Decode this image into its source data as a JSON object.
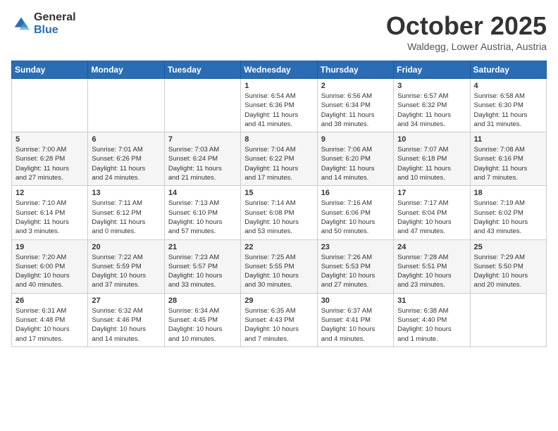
{
  "header": {
    "logo_general": "General",
    "logo_blue": "Blue",
    "month_title": "October 2025",
    "location": "Waldegg, Lower Austria, Austria"
  },
  "weekdays": [
    "Sunday",
    "Monday",
    "Tuesday",
    "Wednesday",
    "Thursday",
    "Friday",
    "Saturday"
  ],
  "weeks": [
    [
      {
        "day": "",
        "info": ""
      },
      {
        "day": "",
        "info": ""
      },
      {
        "day": "",
        "info": ""
      },
      {
        "day": "1",
        "info": "Sunrise: 6:54 AM\nSunset: 6:36 PM\nDaylight: 11 hours\nand 41 minutes."
      },
      {
        "day": "2",
        "info": "Sunrise: 6:56 AM\nSunset: 6:34 PM\nDaylight: 11 hours\nand 38 minutes."
      },
      {
        "day": "3",
        "info": "Sunrise: 6:57 AM\nSunset: 6:32 PM\nDaylight: 11 hours\nand 34 minutes."
      },
      {
        "day": "4",
        "info": "Sunrise: 6:58 AM\nSunset: 6:30 PM\nDaylight: 11 hours\nand 31 minutes."
      }
    ],
    [
      {
        "day": "5",
        "info": "Sunrise: 7:00 AM\nSunset: 6:28 PM\nDaylight: 11 hours\nand 27 minutes."
      },
      {
        "day": "6",
        "info": "Sunrise: 7:01 AM\nSunset: 6:26 PM\nDaylight: 11 hours\nand 24 minutes."
      },
      {
        "day": "7",
        "info": "Sunrise: 7:03 AM\nSunset: 6:24 PM\nDaylight: 11 hours\nand 21 minutes."
      },
      {
        "day": "8",
        "info": "Sunrise: 7:04 AM\nSunset: 6:22 PM\nDaylight: 11 hours\nand 17 minutes."
      },
      {
        "day": "9",
        "info": "Sunrise: 7:06 AM\nSunset: 6:20 PM\nDaylight: 11 hours\nand 14 minutes."
      },
      {
        "day": "10",
        "info": "Sunrise: 7:07 AM\nSunset: 6:18 PM\nDaylight: 11 hours\nand 10 minutes."
      },
      {
        "day": "11",
        "info": "Sunrise: 7:08 AM\nSunset: 6:16 PM\nDaylight: 11 hours\nand 7 minutes."
      }
    ],
    [
      {
        "day": "12",
        "info": "Sunrise: 7:10 AM\nSunset: 6:14 PM\nDaylight: 11 hours\nand 3 minutes."
      },
      {
        "day": "13",
        "info": "Sunrise: 7:11 AM\nSunset: 6:12 PM\nDaylight: 11 hours\nand 0 minutes."
      },
      {
        "day": "14",
        "info": "Sunrise: 7:13 AM\nSunset: 6:10 PM\nDaylight: 10 hours\nand 57 minutes."
      },
      {
        "day": "15",
        "info": "Sunrise: 7:14 AM\nSunset: 6:08 PM\nDaylight: 10 hours\nand 53 minutes."
      },
      {
        "day": "16",
        "info": "Sunrise: 7:16 AM\nSunset: 6:06 PM\nDaylight: 10 hours\nand 50 minutes."
      },
      {
        "day": "17",
        "info": "Sunrise: 7:17 AM\nSunset: 6:04 PM\nDaylight: 10 hours\nand 47 minutes."
      },
      {
        "day": "18",
        "info": "Sunrise: 7:19 AM\nSunset: 6:02 PM\nDaylight: 10 hours\nand 43 minutes."
      }
    ],
    [
      {
        "day": "19",
        "info": "Sunrise: 7:20 AM\nSunset: 6:00 PM\nDaylight: 10 hours\nand 40 minutes."
      },
      {
        "day": "20",
        "info": "Sunrise: 7:22 AM\nSunset: 5:59 PM\nDaylight: 10 hours\nand 37 minutes."
      },
      {
        "day": "21",
        "info": "Sunrise: 7:23 AM\nSunset: 5:57 PM\nDaylight: 10 hours\nand 33 minutes."
      },
      {
        "day": "22",
        "info": "Sunrise: 7:25 AM\nSunset: 5:55 PM\nDaylight: 10 hours\nand 30 minutes."
      },
      {
        "day": "23",
        "info": "Sunrise: 7:26 AM\nSunset: 5:53 PM\nDaylight: 10 hours\nand 27 minutes."
      },
      {
        "day": "24",
        "info": "Sunrise: 7:28 AM\nSunset: 5:51 PM\nDaylight: 10 hours\nand 23 minutes."
      },
      {
        "day": "25",
        "info": "Sunrise: 7:29 AM\nSunset: 5:50 PM\nDaylight: 10 hours\nand 20 minutes."
      }
    ],
    [
      {
        "day": "26",
        "info": "Sunrise: 6:31 AM\nSunset: 4:48 PM\nDaylight: 10 hours\nand 17 minutes."
      },
      {
        "day": "27",
        "info": "Sunrise: 6:32 AM\nSunset: 4:46 PM\nDaylight: 10 hours\nand 14 minutes."
      },
      {
        "day": "28",
        "info": "Sunrise: 6:34 AM\nSunset: 4:45 PM\nDaylight: 10 hours\nand 10 minutes."
      },
      {
        "day": "29",
        "info": "Sunrise: 6:35 AM\nSunset: 4:43 PM\nDaylight: 10 hours\nand 7 minutes."
      },
      {
        "day": "30",
        "info": "Sunrise: 6:37 AM\nSunset: 4:41 PM\nDaylight: 10 hours\nand 4 minutes."
      },
      {
        "day": "31",
        "info": "Sunrise: 6:38 AM\nSunset: 4:40 PM\nDaylight: 10 hours\nand 1 minute."
      },
      {
        "day": "",
        "info": ""
      }
    ]
  ]
}
